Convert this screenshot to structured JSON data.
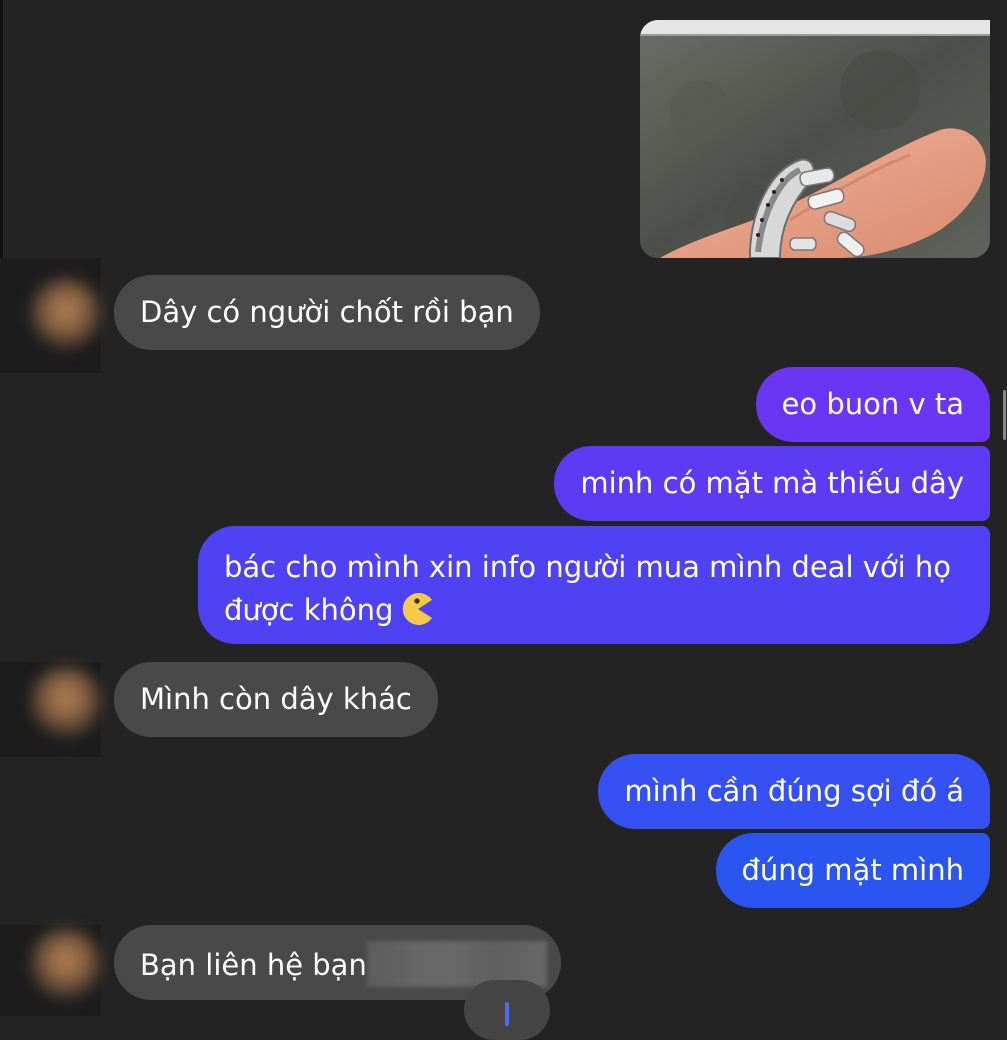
{
  "messages": [
    {
      "id": "m1",
      "direction": "incoming",
      "text": "Dây có người chốt rồi bạn"
    },
    {
      "id": "m2",
      "direction": "outgoing",
      "text": "eo buon v ta"
    },
    {
      "id": "m3",
      "direction": "outgoing",
      "text": "minh có mặt mà thiếu dây"
    },
    {
      "id": "m4",
      "direction": "outgoing",
      "text_line1": "bác cho mình xin info người mua mình deal với họ",
      "text_line2": "được không"
    },
    {
      "id": "m5",
      "direction": "incoming",
      "text": "Mình còn dây khác"
    },
    {
      "id": "m6",
      "direction": "outgoing",
      "text": "mình cần đúng sợi đó á"
    },
    {
      "id": "m7",
      "direction": "outgoing",
      "text": "đúng mặt mình"
    },
    {
      "id": "m8",
      "direction": "incoming",
      "text": "Bạn liên hệ bạn"
    }
  ],
  "icons": {
    "emoji": "pacman-emoji-icon",
    "scroll_down": "arrow-down-icon"
  },
  "colors": {
    "background": "#232323",
    "incoming_bubble": "#494949",
    "outgoing_bubble_top": "#7b2ff0",
    "outgoing_bubble_bottom": "#2a55f0",
    "text": "#ffffff"
  }
}
